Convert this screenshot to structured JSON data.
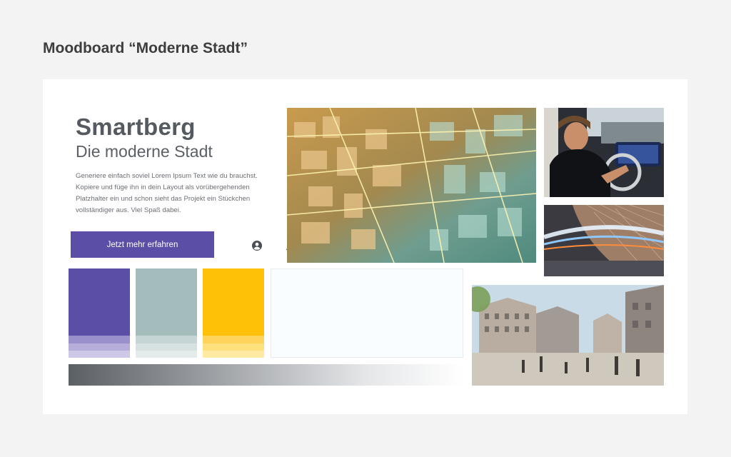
{
  "page_title": "Moodboard “Moderne Stadt”",
  "brand": {
    "name": "Smartberg",
    "tagline": "Die moderne Stadt",
    "body": "Generiere einfach soviel Lorem Ipsum Text wie du brauchst. Kopiere und füge ihn in dein Layout als vorübergehenden Platzhalter ein und schon sieht das Projekt ein Stückchen vollständiger aus. Viel Spaß dabei."
  },
  "cta": {
    "label": "Jetzt mehr erfahren"
  },
  "icons": [
    "user-circle-icon",
    "warning-icon",
    "backpack-icon",
    "bank-icon",
    "notification-bell-icon"
  ],
  "palette": {
    "purple": [
      "#5a4ea6",
      "#9a90cb",
      "#b6addb",
      "#cdc7e8"
    ],
    "sage": [
      "#a4bcbc",
      "#c5d5d5",
      "#d7e1e1",
      "#e4ebeb"
    ],
    "yellow": [
      "#ffc107",
      "#ffd45a",
      "#ffe07f",
      "#ffe9a3"
    ],
    "ice": "#fafdff",
    "gradient_start": "#5b6065"
  },
  "images": [
    "city-3d-map-image",
    "car-dashboard-image",
    "light-trail-architecture-image",
    "urban-plaza-image"
  ]
}
